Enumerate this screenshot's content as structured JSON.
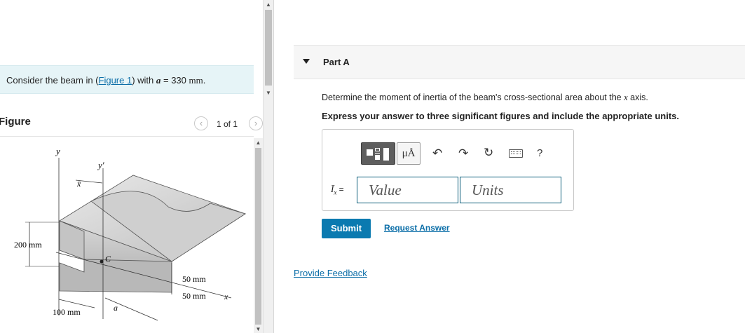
{
  "problem": {
    "prefix": "Consider the beam in (",
    "link": "Figure 1",
    "suffix": ") with ",
    "var": "a",
    "eq": " = 330 ",
    "unit": "mm",
    "end": "."
  },
  "figure": {
    "heading": "Figure",
    "counter": "1 of 1",
    "prev_icon": "chevron-left-icon",
    "next_icon": "chevron-right-icon",
    "labels": {
      "y": "y",
      "y_prime": "y′",
      "x_bar": "x̄",
      "c": "C",
      "a": "a",
      "x": "x",
      "dim_200": "200 mm",
      "dim_100": "100 mm",
      "dim_50a": "50 mm",
      "dim_50b": "50 mm"
    }
  },
  "part": {
    "title": "Part A",
    "question_prefix": "Determine the moment of inertia of the beam's cross-sectional area about the ",
    "question_var": "x",
    "question_suffix": " axis.",
    "instruction": "Express your answer to three significant figures and include the appropriate units.",
    "toolbar": {
      "templates_icon": "templates-icon",
      "units_label": "μÅ",
      "undo_icon": "undo-icon",
      "redo_icon": "redo-icon",
      "reset_icon": "reset-icon",
      "keyboard_icon": "keyboard-icon",
      "help_label": "?"
    },
    "answer_label_var": "Ī",
    "answer_label_sub": "x",
    "answer_label_eq": " =",
    "value_placeholder": "Value",
    "units_placeholder": "Units",
    "submit_label": "Submit",
    "request_label": "Request Answer"
  },
  "feedback_label": "Provide Feedback",
  "colors": {
    "accent": "#0b7ab0",
    "link": "#0b6ea8",
    "problem_bg": "#e6f4f7"
  }
}
